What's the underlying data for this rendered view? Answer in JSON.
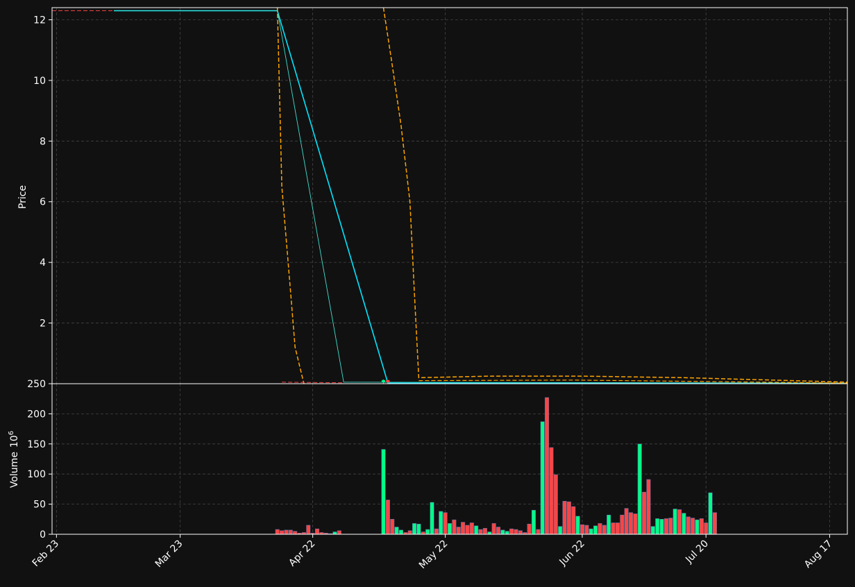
{
  "chart_data": {
    "type": "candlestick",
    "colors": {
      "background": "#111111",
      "axis": "#ffffff",
      "grid": "#444444",
      "up": "#00ff88",
      "down": "#ff4444",
      "line_cyan": "#00e5ff",
      "line_thin": "#40e0d0",
      "band_orange": "#ffa500",
      "red_dashed": "#ff4444"
    },
    "price_panel": {
      "ylabel": "Price",
      "yticks": [
        2,
        4,
        6,
        8,
        10,
        12
      ],
      "ylim": [
        0,
        12.4
      ],
      "grid": true
    },
    "volume_panel": {
      "ylabel": "Volume",
      "ylabel_exponent": "10",
      "ylabel_power": "6",
      "yticks": [
        0,
        50,
        100,
        150,
        200,
        250
      ],
      "ylim": [
        0,
        250
      ],
      "grid": true
    },
    "x_axis": {
      "range": [
        "2023-02-22",
        "2023-08-21"
      ],
      "ticks": [
        {
          "date": "2023-02-23",
          "label": "Feb 23"
        },
        {
          "date": "2023-03-23",
          "label": "Mar 23"
        },
        {
          "date": "2023-04-22",
          "label": "Apr 22"
        },
        {
          "date": "2023-05-22",
          "label": "May 22"
        },
        {
          "date": "2023-06-22",
          "label": "Jun 22"
        },
        {
          "date": "2023-07-20",
          "label": "Jul 20"
        },
        {
          "date": "2023-08-17",
          "label": "Aug 17"
        }
      ]
    },
    "lines": [
      {
        "style": "solid",
        "color_key": "line_cyan",
        "width": 1.6,
        "points": [
          [
            "2023-03-08",
            12.3
          ],
          [
            "2023-04-14",
            12.3
          ],
          [
            "2023-05-09",
            0.02
          ],
          [
            "2023-08-21",
            0.01
          ]
        ]
      },
      {
        "style": "solid",
        "color_key": "line_thin",
        "width": 0.9,
        "points": [
          [
            "2023-03-08",
            12.3
          ],
          [
            "2023-04-14",
            12.3
          ],
          [
            "2023-04-29",
            0.05
          ],
          [
            "2023-08-21",
            0.02
          ]
        ]
      },
      {
        "style": "dashed",
        "color_key": "band_orange",
        "width": 1.5,
        "points": [
          [
            "2023-04-14",
            12.4
          ],
          [
            "2023-04-15",
            6.5
          ],
          [
            "2023-04-17",
            3.0
          ],
          [
            "2023-04-18",
            1.2
          ],
          [
            "2023-04-20",
            0.0
          ]
        ]
      },
      {
        "style": "dashed",
        "color_key": "band_orange",
        "width": 1.5,
        "points": [
          [
            "2023-05-08",
            12.4
          ],
          [
            "2023-05-10",
            10.5
          ],
          [
            "2023-05-12",
            8.5
          ],
          [
            "2023-05-14",
            6.0
          ],
          [
            "2023-05-15",
            3.0
          ],
          [
            "2023-05-16",
            0.2
          ],
          [
            "2023-05-23",
            0.22
          ],
          [
            "2023-06-01",
            0.25
          ],
          [
            "2023-06-22",
            0.25
          ],
          [
            "2023-07-15",
            0.2
          ],
          [
            "2023-08-21",
            0.05
          ]
        ]
      },
      {
        "style": "dashed",
        "color_key": "band_orange",
        "width": 1.2,
        "points": [
          [
            "2023-05-16",
            0.1
          ],
          [
            "2023-06-20",
            0.12
          ],
          [
            "2023-08-21",
            0.02
          ]
        ]
      },
      {
        "style": "dashed",
        "color_key": "red_dashed",
        "width": 1.0,
        "points": [
          [
            "2023-02-22",
            12.3
          ],
          [
            "2023-03-08",
            12.3
          ]
        ]
      },
      {
        "style": "dashed",
        "color_key": "red_dashed",
        "width": 1.0,
        "points": [
          [
            "2023-04-15",
            0.05
          ],
          [
            "2023-04-29",
            0.03
          ]
        ]
      }
    ],
    "candles": [
      {
        "date": "2023-05-08",
        "open": 0.05,
        "close": 0.12,
        "high": 0.14,
        "low": 0.0
      },
      {
        "date": "2023-05-09",
        "open": 0.12,
        "close": 0.05,
        "high": 0.13,
        "low": 0.0
      }
    ],
    "volume": [
      {
        "date": "2023-04-14",
        "value": 8,
        "dir": "down"
      },
      {
        "date": "2023-04-15",
        "value": 6,
        "dir": "down"
      },
      {
        "date": "2023-04-16",
        "value": 7,
        "dir": "down"
      },
      {
        "date": "2023-04-17",
        "value": 7,
        "dir": "down"
      },
      {
        "date": "2023-04-18",
        "value": 5,
        "dir": "down"
      },
      {
        "date": "2023-04-19",
        "value": 2,
        "dir": "down"
      },
      {
        "date": "2023-04-20",
        "value": 3,
        "dir": "down"
      },
      {
        "date": "2023-04-21",
        "value": 15,
        "dir": "down"
      },
      {
        "date": "2023-04-22",
        "value": 2,
        "dir": "down"
      },
      {
        "date": "2023-04-23",
        "value": 9,
        "dir": "down"
      },
      {
        "date": "2023-04-24",
        "value": 3,
        "dir": "down"
      },
      {
        "date": "2023-04-25",
        "value": 2,
        "dir": "down"
      },
      {
        "date": "2023-04-26",
        "value": 1,
        "dir": "down"
      },
      {
        "date": "2023-04-27",
        "value": 4,
        "dir": "up"
      },
      {
        "date": "2023-04-28",
        "value": 6,
        "dir": "down"
      },
      {
        "date": "2023-05-08",
        "value": 141,
        "dir": "up"
      },
      {
        "date": "2023-05-09",
        "value": 57,
        "dir": "down"
      },
      {
        "date": "2023-05-10",
        "value": 25,
        "dir": "down"
      },
      {
        "date": "2023-05-11",
        "value": 12,
        "dir": "up"
      },
      {
        "date": "2023-05-12",
        "value": 7,
        "dir": "up"
      },
      {
        "date": "2023-05-13",
        "value": 3,
        "dir": "down"
      },
      {
        "date": "2023-05-14",
        "value": 6,
        "dir": "down"
      },
      {
        "date": "2023-05-15",
        "value": 18,
        "dir": "up"
      },
      {
        "date": "2023-05-16",
        "value": 17,
        "dir": "up"
      },
      {
        "date": "2023-05-17",
        "value": 4,
        "dir": "down"
      },
      {
        "date": "2023-05-18",
        "value": 8,
        "dir": "up"
      },
      {
        "date": "2023-05-19",
        "value": 53,
        "dir": "up"
      },
      {
        "date": "2023-05-20",
        "value": 9,
        "dir": "down"
      },
      {
        "date": "2023-05-21",
        "value": 38,
        "dir": "up"
      },
      {
        "date": "2023-05-22",
        "value": 36,
        "dir": "down"
      },
      {
        "date": "2023-05-23",
        "value": 18,
        "dir": "up"
      },
      {
        "date": "2023-05-24",
        "value": 24,
        "dir": "down"
      },
      {
        "date": "2023-05-25",
        "value": 12,
        "dir": "down"
      },
      {
        "date": "2023-05-26",
        "value": 20,
        "dir": "down"
      },
      {
        "date": "2023-05-27",
        "value": 15,
        "dir": "down"
      },
      {
        "date": "2023-05-28",
        "value": 19,
        "dir": "down"
      },
      {
        "date": "2023-05-29",
        "value": 14,
        "dir": "up"
      },
      {
        "date": "2023-05-30",
        "value": 8,
        "dir": "down"
      },
      {
        "date": "2023-05-31",
        "value": 10,
        "dir": "down"
      },
      {
        "date": "2023-06-01",
        "value": 4,
        "dir": "up"
      },
      {
        "date": "2023-06-02",
        "value": 18,
        "dir": "down"
      },
      {
        "date": "2023-06-03",
        "value": 12,
        "dir": "down"
      },
      {
        "date": "2023-06-04",
        "value": 7,
        "dir": "up"
      },
      {
        "date": "2023-06-05",
        "value": 5,
        "dir": "up"
      },
      {
        "date": "2023-06-06",
        "value": 9,
        "dir": "down"
      },
      {
        "date": "2023-06-07",
        "value": 8,
        "dir": "down"
      },
      {
        "date": "2023-06-08",
        "value": 6,
        "dir": "down"
      },
      {
        "date": "2023-06-09",
        "value": 3,
        "dir": "down"
      },
      {
        "date": "2023-06-10",
        "value": 17,
        "dir": "down"
      },
      {
        "date": "2023-06-11",
        "value": 40,
        "dir": "up"
      },
      {
        "date": "2023-06-12",
        "value": 8,
        "dir": "down"
      },
      {
        "date": "2023-06-13",
        "value": 187,
        "dir": "up"
      },
      {
        "date": "2023-06-14",
        "value": 227,
        "dir": "down"
      },
      {
        "date": "2023-06-15",
        "value": 144,
        "dir": "down"
      },
      {
        "date": "2023-06-16",
        "value": 99,
        "dir": "down"
      },
      {
        "date": "2023-06-17",
        "value": 13,
        "dir": "up"
      },
      {
        "date": "2023-06-18",
        "value": 55,
        "dir": "down"
      },
      {
        "date": "2023-06-19",
        "value": 54,
        "dir": "down"
      },
      {
        "date": "2023-06-20",
        "value": 46,
        "dir": "down"
      },
      {
        "date": "2023-06-21",
        "value": 30,
        "dir": "up"
      },
      {
        "date": "2023-06-22",
        "value": 16,
        "dir": "down"
      },
      {
        "date": "2023-06-23",
        "value": 15,
        "dir": "down"
      },
      {
        "date": "2023-06-24",
        "value": 9,
        "dir": "up"
      },
      {
        "date": "2023-06-25",
        "value": 14,
        "dir": "up"
      },
      {
        "date": "2023-06-26",
        "value": 18,
        "dir": "down"
      },
      {
        "date": "2023-06-27",
        "value": 15,
        "dir": "down"
      },
      {
        "date": "2023-06-28",
        "value": 32,
        "dir": "up"
      },
      {
        "date": "2023-06-29",
        "value": 19,
        "dir": "down"
      },
      {
        "date": "2023-06-30",
        "value": 19,
        "dir": "down"
      },
      {
        "date": "2023-07-01",
        "value": 32,
        "dir": "down"
      },
      {
        "date": "2023-07-02",
        "value": 43,
        "dir": "down"
      },
      {
        "date": "2023-07-03",
        "value": 36,
        "dir": "down"
      },
      {
        "date": "2023-07-04",
        "value": 34,
        "dir": "down"
      },
      {
        "date": "2023-07-05",
        "value": 150,
        "dir": "up"
      },
      {
        "date": "2023-07-06",
        "value": 70,
        "dir": "down"
      },
      {
        "date": "2023-07-07",
        "value": 91,
        "dir": "down"
      },
      {
        "date": "2023-07-08",
        "value": 13,
        "dir": "up"
      },
      {
        "date": "2023-07-09",
        "value": 26,
        "dir": "up"
      },
      {
        "date": "2023-07-10",
        "value": 25,
        "dir": "up"
      },
      {
        "date": "2023-07-11",
        "value": 26,
        "dir": "down"
      },
      {
        "date": "2023-07-12",
        "value": 27,
        "dir": "down"
      },
      {
        "date": "2023-07-13",
        "value": 42,
        "dir": "up"
      },
      {
        "date": "2023-07-14",
        "value": 41,
        "dir": "down"
      },
      {
        "date": "2023-07-15",
        "value": 35,
        "dir": "up"
      },
      {
        "date": "2023-07-16",
        "value": 29,
        "dir": "down"
      },
      {
        "date": "2023-07-17",
        "value": 27,
        "dir": "down"
      },
      {
        "date": "2023-07-18",
        "value": 24,
        "dir": "up"
      },
      {
        "date": "2023-07-19",
        "value": 26,
        "dir": "down"
      },
      {
        "date": "2023-07-20",
        "value": 19,
        "dir": "down"
      },
      {
        "date": "2023-07-21",
        "value": 69,
        "dir": "up"
      },
      {
        "date": "2023-07-22",
        "value": 36,
        "dir": "down"
      }
    ]
  }
}
